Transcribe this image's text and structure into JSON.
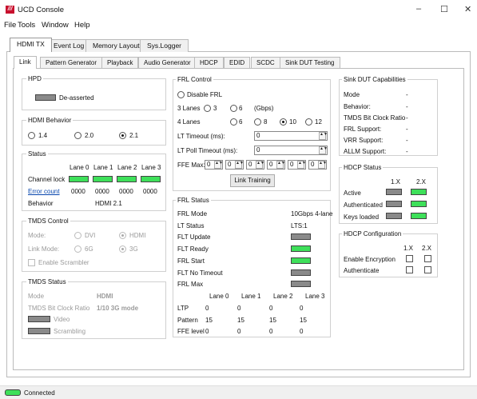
{
  "window": {
    "title": "UCD Console",
    "logo_text": "///",
    "minimize": "–",
    "maximize": "☐",
    "close": "✕"
  },
  "menu": [
    {
      "label": "File"
    },
    {
      "label": "Tools"
    },
    {
      "label": "Window"
    },
    {
      "label": "Help"
    }
  ],
  "main_tabs": [
    "HDMI TX",
    "Event Log",
    "Memory Layout",
    "Sys.Logger"
  ],
  "sub_tabs": [
    "Link",
    "Pattern Generator",
    "Playback",
    "Audio Generator",
    "HDCP",
    "EDID",
    "SCDC",
    "Sink DUT Testing"
  ],
  "hpd": {
    "title": "HPD",
    "state": "De-asserted",
    "led": "grey"
  },
  "hdmi_behavior": {
    "title": "HDMI Behavior",
    "options": [
      "1.4",
      "2.0",
      "2.1"
    ],
    "selected": "2.1"
  },
  "status": {
    "title": "Status",
    "lanes": [
      "Lane 0",
      "Lane 1",
      "Lane 2",
      "Lane 3"
    ],
    "channel_lock_label": "Channel lock",
    "channel_lock": [
      "green",
      "green",
      "green",
      "green"
    ],
    "error_count_label": "Error count",
    "error_count": [
      "0000",
      "0000",
      "0000",
      "0000"
    ],
    "behavior_label": "Behavior",
    "behavior_value": "HDMI 2.1"
  },
  "tmds_control": {
    "title": "TMDS Control",
    "mode_label": "Mode:",
    "mode_options": [
      "DVI",
      "HDMI"
    ],
    "mode_selected": "HDMI",
    "link_mode_label": "Link Mode:",
    "link_mode_options": [
      "6G",
      "3G"
    ],
    "link_mode_selected": "3G",
    "scrambler_label": "Enable Scrambler"
  },
  "tmds_status": {
    "title": "TMDS Status",
    "mode_label": "Mode",
    "mode_value": "HDMI",
    "ratio_label": "TMDS Bit Clock Ratio",
    "ratio_value": "1/10 3G mode",
    "video_label": "Video",
    "scrambling_label": "Scrambling"
  },
  "frl_control": {
    "title": "FRL Control",
    "disable_label": "Disable FRL",
    "lanes3_label": "3 Lanes",
    "lanes3_options": [
      "3",
      "6"
    ],
    "gbps_label": "(Gbps)",
    "lanes4_label": "4 Lanes",
    "lanes4_options": [
      "6",
      "8",
      "10",
      "12"
    ],
    "selected": "10",
    "lt_timeout_label": "LT Timeout (ms):",
    "lt_timeout_value": "0",
    "lt_poll_label": "LT Poll Timeout (ms):",
    "lt_poll_value": "0",
    "ffe_label": "FFE Max:",
    "ffe_values": [
      "0",
      "0",
      "0",
      "0",
      "0",
      "0"
    ],
    "link_training_button": "Link Training"
  },
  "frl_status": {
    "title": "FRL Status",
    "frl_mode_label": "FRL Mode",
    "frl_mode_value": "10Gbps 4-lane",
    "lt_status_label": "LT Status",
    "lt_status_value": "LTS:1",
    "flags": [
      {
        "label": "FLT Update",
        "led": "grey"
      },
      {
        "label": "FLT Ready",
        "led": "green"
      },
      {
        "label": "FRL Start",
        "led": "green"
      },
      {
        "label": "FLT No Timeout",
        "led": "grey"
      },
      {
        "label": "FRL Max",
        "led": "grey"
      }
    ],
    "lanes": [
      "Lane 0",
      "Lane 1",
      "Lane 2",
      "Lane 3"
    ],
    "rows": [
      {
        "label": "LTP",
        "values": [
          "0",
          "0",
          "0",
          "0"
        ]
      },
      {
        "label": "Pattern",
        "values": [
          "15",
          "15",
          "15",
          "15"
        ]
      },
      {
        "label": "FFE level",
        "values": [
          "0",
          "0",
          "0",
          "0"
        ]
      }
    ]
  },
  "sink_caps": {
    "title": "Sink DUT Capabilities",
    "items": [
      {
        "label": "Mode",
        "value": "-"
      },
      {
        "label": "Behavior:",
        "value": "-"
      },
      {
        "label": "TMDS Bit Clock Ratio",
        "value": "-"
      },
      {
        "label": "FRL Support:",
        "value": "-"
      },
      {
        "label": "VRR Support:",
        "value": "-"
      },
      {
        "label": "ALLM Support:",
        "value": "-"
      }
    ]
  },
  "hdcp_status": {
    "title": "HDCP Status",
    "cols": [
      "1.X",
      "2.X"
    ],
    "rows": [
      {
        "label": "Active",
        "leds": [
          "grey",
          "green"
        ]
      },
      {
        "label": "Authenticated",
        "leds": [
          "grey",
          "green"
        ]
      },
      {
        "label": "Keys loaded",
        "leds": [
          "grey",
          "green"
        ]
      }
    ]
  },
  "hdcp_config": {
    "title": "HDCP Configuration",
    "cols": [
      "1.X",
      "2.X"
    ],
    "rows": [
      {
        "label": "Enable Encryption"
      },
      {
        "label": "Authenticate"
      }
    ]
  },
  "statusbar": {
    "text": "Connected"
  }
}
